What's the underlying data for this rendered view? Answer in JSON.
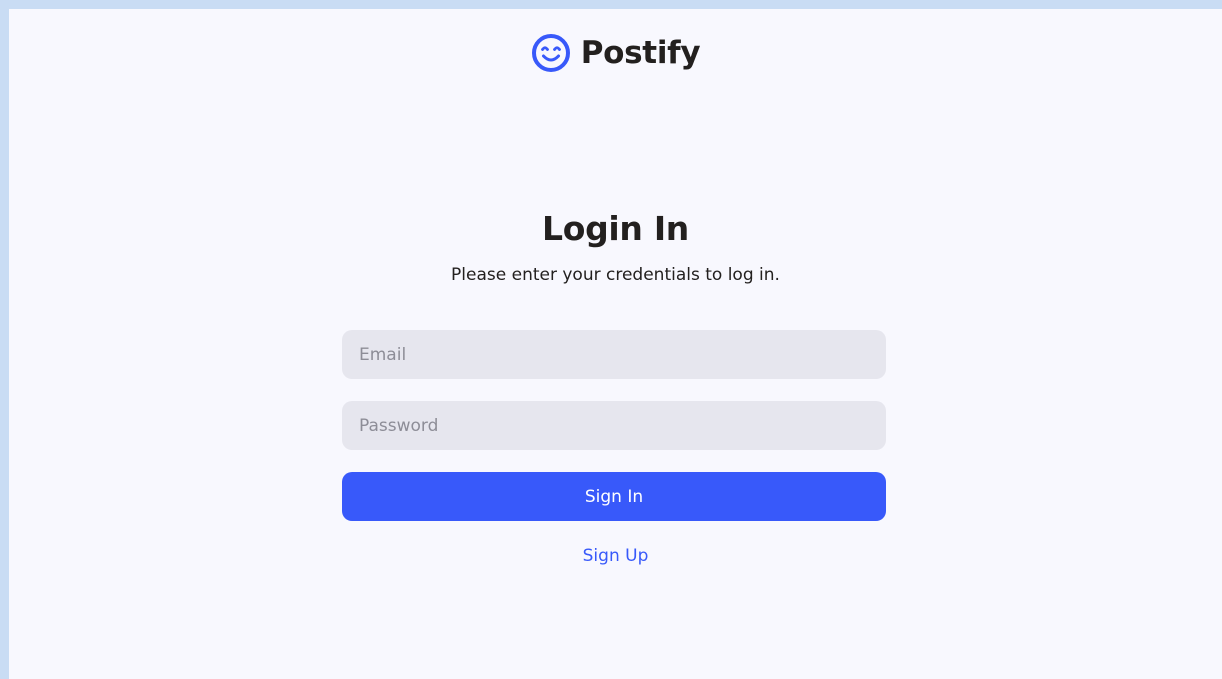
{
  "brand": {
    "name": "Postify",
    "icon": "smiley-face-icon",
    "color": "#3859fa"
  },
  "login": {
    "title": "Login In",
    "subtitle": "Please enter your credentials to log in.",
    "email": {
      "placeholder": "Email",
      "value": ""
    },
    "password": {
      "placeholder": "Password",
      "value": ""
    },
    "sign_in_label": "Sign In",
    "sign_up_label": "Sign Up"
  },
  "colors": {
    "accent": "#3859fa",
    "page_background": "#f8f8fe",
    "frame_border": "#c9dcf4",
    "input_background": "#e6e6ee",
    "text_dark": "#23201f"
  }
}
